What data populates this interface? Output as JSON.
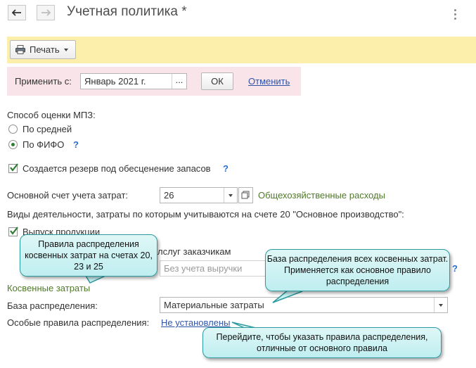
{
  "header": {
    "title": "Учетная политика *",
    "back_icon": "arrow-left-icon",
    "forward_icon": "arrow-right-icon"
  },
  "toolbar": {
    "print_label": "Печать"
  },
  "apply": {
    "label": "Применить с:",
    "date_value": "Январь 2021 г.",
    "ellipsis": "...",
    "ok_label": "ОК",
    "cancel_label": "Отменить"
  },
  "valuation": {
    "label": "Способ оценки МПЗ:",
    "options": [
      {
        "label": "По средней",
        "selected": false
      },
      {
        "label": "По ФИФО",
        "selected": true
      }
    ],
    "help": "?"
  },
  "reserve": {
    "label": "Создается резерв под обесценение запасов",
    "checked": true,
    "help": "?"
  },
  "cost_account": {
    "label": "Основной счет учета затрат:",
    "value": "26",
    "description": "Общехозяйственные расходы"
  },
  "activities": {
    "label": "Виды деятельности, затраты по которым учитываются на счете 20 \"Основное производство\":",
    "items": [
      {
        "label": "Выпуск продукции",
        "checked": true
      },
      {
        "label": "лслуг заказчикам",
        "checked": true
      }
    ],
    "revenue_placeholder": "Без учета выручки",
    "help": "?"
  },
  "indirect": {
    "section_title": "Косвенные затраты",
    "base_label": "База распределения:",
    "base_value": "Материальные затраты",
    "rules_label": "Особые правила распределения:",
    "rules_link": "Не установлены"
  },
  "callouts": {
    "c1": "Правила распределения косвенных затрат на счетах 20, 23 и 25",
    "c2": "База распределения всех косвенных затрат. Применяется как основное правило распределения",
    "c3": "Перейдите, чтобы указать правила распределения, отличные от основного правила"
  },
  "colors": {
    "toolbar_bg": "#fbefab",
    "apply_bg": "#f9e4ea",
    "link": "#2f55a8",
    "help": "#2a6fd0",
    "section_green": "#4f7a28",
    "callout_border": "#2c9a9f"
  }
}
